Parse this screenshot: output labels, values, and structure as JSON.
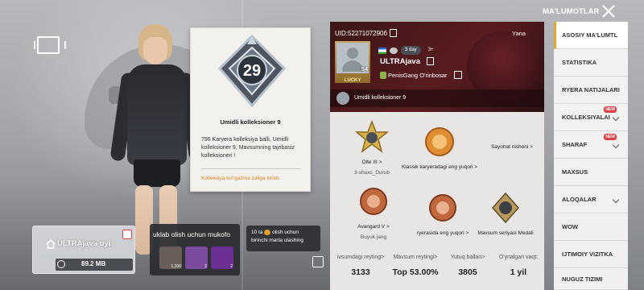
{
  "header": {
    "title": "MA'LUMOTLAR"
  },
  "tooltip": {
    "level": "29",
    "title": "Umidli kolleksioner 9",
    "description": "796 Karyera kolleksiya balli, Umidli kolleksioner 9, Mavsumning tajribasiz kolleksioneri !",
    "link": "Kolleksiya ko'rgazma zaliga kirish"
  },
  "home": {
    "label": "ULTRAjava uyi",
    "size": "89.2 MB"
  },
  "reward": {
    "title": "uklab olish uchun mukofo",
    "items": [
      {
        "count": "1,200"
      },
      {
        "count": "2"
      },
      {
        "count": "2"
      }
    ]
  },
  "first_time": {
    "line1_pre": "10 ta",
    "line1_post": "olish uchun",
    "line2": "birinchi marta ulashing"
  },
  "profile": {
    "uid": "UID:5227107290б",
    "region": "Yana",
    "level": "54",
    "lucky": "LUCKY",
    "days": "3 day",
    "friends": "3+",
    "name": "ULTRAjava",
    "crew": "PenisGang  O'rinbosar",
    "collection": "Umidli kolleksioner 9"
  },
  "badges": [
    {
      "label1": "Olte III >",
      "label2": "3-shaxs_Durub"
    },
    {
      "label1": "Klassik karyeradagi eng yuqori >",
      "label2": ""
    },
    {
      "label1": "Sayohat nishoni >",
      "label2": ""
    },
    {
      "label1": "Avangard V >",
      "label2": "Buyuk jang"
    },
    {
      "label1": "ryerasida eng yuqori >",
      "label2": ""
    },
    {
      "label1": "Mavsum seriyasi Medali",
      "label2": ""
    }
  ],
  "stats": [
    {
      "label": "ivsumdagi reyting>",
      "value": "3133"
    },
    {
      "label": "Mavsum reytingi>",
      "value": "Top 53.00%"
    },
    {
      "label": "Yutuq ballari>",
      "value": "3805"
    },
    {
      "label": "O'ynalgan vaqt:",
      "value": "1 yil"
    }
  ],
  "sidebar": {
    "items": [
      {
        "label": "ASOSIY MA'LUMTL",
        "active": true
      },
      {
        "label": "STATISTIKA"
      },
      {
        "label": "RYERA NATIJALARI"
      },
      {
        "label": "KOLLEKSIYALAI",
        "new": "NEW"
      },
      {
        "label": "SHARAF",
        "new": "NEW"
      },
      {
        "label": "MAXSUS"
      },
      {
        "label": "ALOQALAR"
      },
      {
        "label": "WOW"
      },
      {
        "label": "IJTIMOIY VIZITKA"
      },
      {
        "label": "NUGUZ TIZIMI"
      }
    ]
  },
  "colors": {
    "accent": "#e4a72a",
    "link": "#d8811b",
    "banner": "#5a1c1f"
  }
}
